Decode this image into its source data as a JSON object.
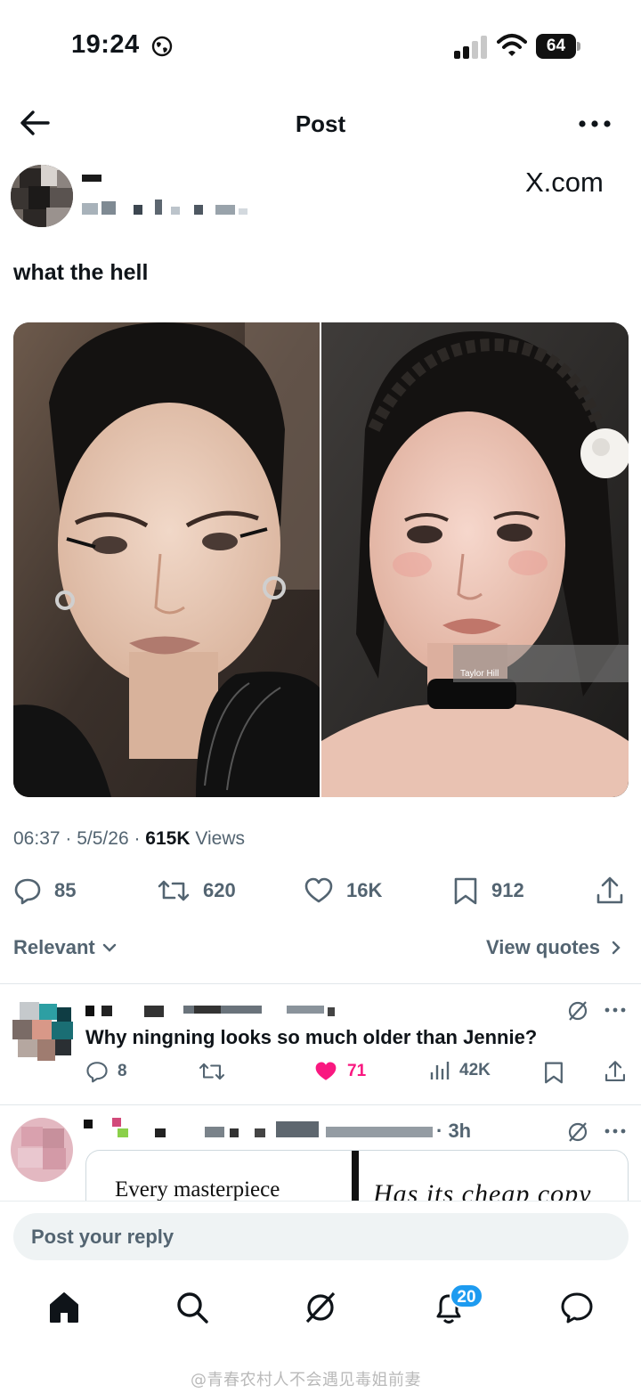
{
  "status_bar": {
    "time": "19:24",
    "battery": "64"
  },
  "nav": {
    "title": "Post"
  },
  "author": {
    "source_label": "X.com"
  },
  "post": {
    "text": "what the hell",
    "time": "06:37",
    "date": "5/5/26",
    "views_count": "615K",
    "views_label": "Views",
    "image_watermark": "Taylor Hill",
    "stats": {
      "replies": "85",
      "reposts": "620",
      "likes": "16K",
      "bookmarks": "912"
    }
  },
  "replies_filter": {
    "sort_label": "Relevant",
    "view_quotes_label": "View quotes"
  },
  "replies": [
    {
      "text": "Why ningning looks so much older than Jennie?",
      "stats": {
        "replies": "8",
        "likes": "71",
        "views": "42K"
      },
      "liked": true
    },
    {
      "time_suffix": "· 3h",
      "quote_left": "Every masterpiece",
      "quote_right": "Has its cheap copy"
    }
  ],
  "composer": {
    "placeholder": "Post your reply"
  },
  "tabbar": {
    "notifications_badge": "20"
  },
  "watermark": "@青春农村人不会遇见毒姐前妻",
  "colors": {
    "accent": "#1d9bf0",
    "like": "#f91880",
    "secondary_text": "#536471"
  },
  "icons": [
    "globe-icon",
    "signal-icon",
    "wifi-icon",
    "battery-icon",
    "back-arrow-icon",
    "more-icon",
    "reply-icon",
    "repost-icon",
    "like-icon",
    "bookmark-icon",
    "share-icon",
    "chevron-down-icon",
    "chevron-right-icon",
    "grok-icon",
    "views-icon",
    "home-icon",
    "search-icon",
    "notifications-icon",
    "messages-icon"
  ]
}
